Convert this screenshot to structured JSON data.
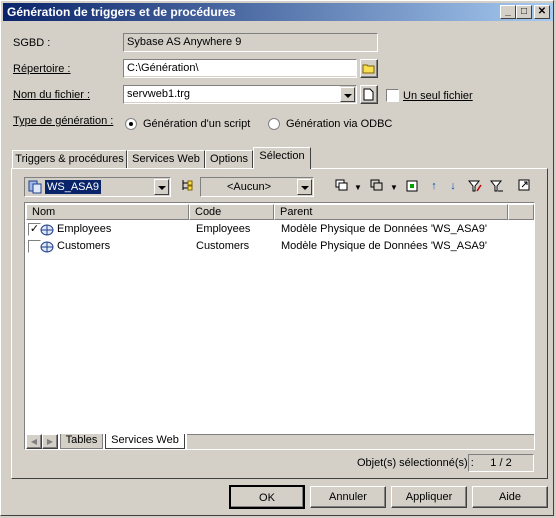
{
  "window": {
    "title": "Génération de triggers et de procédures",
    "controls": [
      "minimize-icon",
      "maximize-icon",
      "close-icon"
    ]
  },
  "form": {
    "sgbd_label": "SGBD :",
    "sgbd_value": "Sybase AS Anywhere 9",
    "repertoire_label": "Répertoire :",
    "repertoire_value": "C:\\Génération\\",
    "fichier_label": "Nom du fichier :",
    "fichier_value": "servweb1.trg",
    "un_seul_fichier_label": "Un seul fichier",
    "un_seul_fichier_checked": false,
    "type_label": "Type de génération :",
    "radio_script": "Génération d'un script",
    "radio_odbc": "Génération via ODBC",
    "selected_type": "script"
  },
  "tabs": [
    {
      "label": "Triggers & procédures",
      "active": false
    },
    {
      "label": "Services Web",
      "active": false
    },
    {
      "label": "Options",
      "active": false
    },
    {
      "label": "Sélection",
      "active": true
    }
  ],
  "selection": {
    "model_value": "WS_ASA9",
    "filter_value": "<Aucun>",
    "columns": [
      "Nom",
      "Code",
      "Parent"
    ],
    "rows": [
      {
        "checked": true,
        "name": "Employees",
        "code": "Employees",
        "parent": "Modèle Physique de Données 'WS_ASA9'"
      },
      {
        "checked": false,
        "name": "Customers",
        "code": "Customers",
        "parent": "Modèle Physique de Données 'WS_ASA9'"
      }
    ],
    "bottom_tabs": [
      {
        "label": "Tables",
        "active": false
      },
      {
        "label": "Services Web",
        "active": true
      }
    ],
    "status_label": "Objet(s) sélectionné(s) :",
    "status_count": "1 / 2"
  },
  "buttons": {
    "ok": "OK",
    "annuler": "Annuler",
    "appliquer": "Appliquer",
    "aide": "Aide"
  },
  "colors": {
    "title_start": "#0a246a",
    "title_end": "#a6caf0",
    "face": "#d4d0c8",
    "selection": "#0a246a"
  }
}
